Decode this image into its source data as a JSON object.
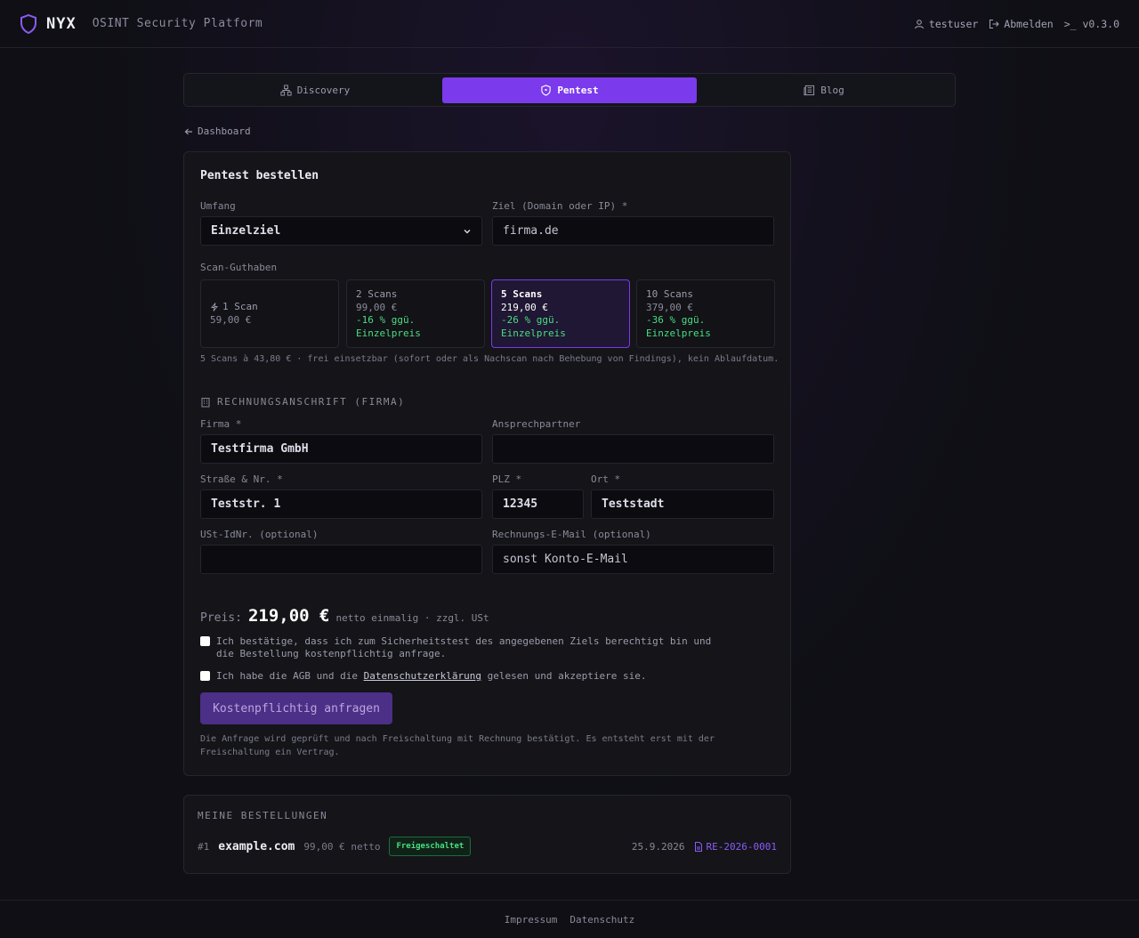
{
  "header": {
    "brand": "NYX",
    "subtitle": "OSINT Security Platform",
    "user": "testuser",
    "logout": "Abmelden",
    "version": ">_ v0.3.0"
  },
  "tabs": [
    {
      "label": "Discovery",
      "icon": "network-icon",
      "active": false
    },
    {
      "label": "Pentest",
      "icon": "shield-icon",
      "active": true
    },
    {
      "label": "Blog",
      "icon": "newspaper-icon",
      "active": false
    }
  ],
  "back_link": "Dashboard",
  "form": {
    "title": "Pentest bestellen",
    "scope_label": "Umfang",
    "scope_value": "Einzelziel",
    "target_label": "Ziel (Domain oder IP) *",
    "target_value": "firma.de",
    "credits_label": "Scan-Guthaben",
    "credits": [
      {
        "title": "1 Scan",
        "price": "59,00 €",
        "saving": "",
        "saving_note": ""
      },
      {
        "title": "2 Scans",
        "price": "99,00 €",
        "saving": "-16 % ggü.",
        "saving_note": "Einzelpreis"
      },
      {
        "title": "5 Scans",
        "price": "219,00 €",
        "saving": "-26 % ggü.",
        "saving_note": "Einzelpreis"
      },
      {
        "title": "10 Scans",
        "price": "379,00 €",
        "saving": "-36 % ggü.",
        "saving_note": "Einzelpreis"
      }
    ],
    "selected_credit": 2,
    "credits_note": "5 Scans à 43,80 € · frei einsetzbar (sofort oder als Nachscan nach Behebung von Findings), kein Ablaufdatum.",
    "billing_section": "RECHNUNGSANSCHRIFT (FIRMA)",
    "company_label": "Firma *",
    "company_value": "Testfirma GmbH",
    "contact_label": "Ansprechpartner",
    "contact_value": "",
    "street_label": "Straße & Nr. *",
    "street_value": "Teststr. 1",
    "zip_label": "PLZ *",
    "zip_value": "12345",
    "city_label": "Ort *",
    "city_value": "Teststadt",
    "vat_label": "USt-IdNr. (optional)",
    "vat_value": "",
    "invoice_email_label": "Rechnungs-E-Mail (optional)",
    "invoice_email_placeholder": "sonst Konto-E-Mail",
    "price_label": "Preis:",
    "price_value": "219,00 €",
    "price_suffix": "netto einmalig · zzgl. USt",
    "confirm_text": "Ich bestätige, dass ich zum Sicherheitstest des angegebenen Ziels berechtigt bin und die Bestellung kostenpflichtig anfrage.",
    "agb_prefix": "Ich habe die AGB und die",
    "agb_link": "Datenschutzerklärung",
    "agb_suffix": "gelesen und akzeptiere sie.",
    "submit_label": "Kostenpflichtig anfragen",
    "footnote": "Die Anfrage wird geprüft und nach Freischaltung mit Rechnung bestätigt. Es entsteht erst mit der Freischaltung ein Vertrag."
  },
  "orders": {
    "title": "MEINE BESTELLUNGEN",
    "items": [
      {
        "num": "#1",
        "domain": "example.com",
        "amount": "99,00 € netto",
        "status": "Freigeschaltet",
        "date": "25.9.2026",
        "invoice": "RE-2026-0001"
      }
    ]
  },
  "footer": {
    "impressum": "Impressum",
    "datenschutz": "Datenschutz"
  },
  "colors": {
    "accent": "#7c3aed",
    "success": "#4ade80",
    "background": "#0f0f15"
  }
}
